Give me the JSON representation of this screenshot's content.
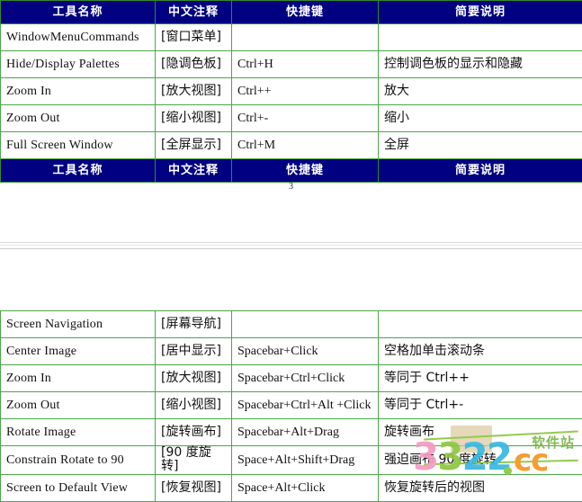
{
  "document": {
    "page_number": "3",
    "columns": [
      "工具名称",
      "中文注释",
      "快捷键",
      "简要说明"
    ]
  },
  "table_one": {
    "header": {
      "col1": "工具名称",
      "col2": "中文注释",
      "col3": "快捷键",
      "col4": "简要说明"
    },
    "footer_header": {
      "col1": "工具名称",
      "col2": "中文注释",
      "col3": "快捷键",
      "col4": "简要说明"
    },
    "rows": [
      {
        "name": "WindowMenuCommands",
        "cn": "[窗口菜单]",
        "key": "",
        "desc": "",
        "bold_name": true,
        "bold_key": false
      },
      {
        "name": "Hide/Display Palettes",
        "cn": "[隐调色板]",
        "key": "Ctrl+H",
        "desc": "控制调色板的显示和隐藏",
        "bold_name": false,
        "bold_key": false
      },
      {
        "name": "Zoom In",
        "cn": "[放大视图]",
        "key": "Ctrl++",
        "desc": "放大",
        "bold_name": false,
        "bold_key": false
      },
      {
        "name": "Zoom Out",
        "cn": "[缩小视图]",
        "key": "Ctrl+-",
        "desc": "缩小",
        "bold_name": false,
        "bold_key": false
      },
      {
        "name": "Full Screen Window",
        "cn": "[全屏显示]",
        "key": "Ctrl+M",
        "desc": "全屏",
        "bold_name": false,
        "bold_key": false
      }
    ]
  },
  "table_two": {
    "rows": [
      {
        "name": "Screen Navigation",
        "cn": "[屏幕导航]",
        "key": "",
        "desc": "",
        "bold_name": false,
        "bold_key": false
      },
      {
        "name": "Center Image",
        "cn": "[居中显示]",
        "key": "Spacebar+Click",
        "desc": "空格加单击滚动条",
        "bold_name": false,
        "bold_key": false
      },
      {
        "name": "Zoom In",
        "cn": "[放大视图]",
        "key": "Spacebar+Ctrl+Click",
        "desc": "等同于 Ctrl++",
        "bold_name": false,
        "bold_key": false
      },
      {
        "name": "Zoom Out",
        "cn": "[缩小视图]",
        "key": "Spacebar+Ctrl+Alt +Click",
        "desc": "等同于 Ctrl+-",
        "bold_name": false,
        "bold_key": true
      },
      {
        "name": "Rotate Image",
        "cn": "[旋转画布]",
        "key": "Spacebar+Alt+Drag",
        "desc": "旋转画布",
        "bold_name": false,
        "bold_key": false
      },
      {
        "name": "Constrain Rotate to 90",
        "cn": "[90 度旋转]",
        "key": "Space+Alt+Shift+Drag",
        "desc": "强迫画布 90 度旋转",
        "bold_name": false,
        "bold_key": false
      },
      {
        "name": "Screen to Default View",
        "cn": "[恢复视图]",
        "key": "Space+Alt+Click",
        "desc": "恢复旋转后的视图",
        "bold_name": false,
        "bold_key": false
      }
    ]
  },
  "watermark": {
    "digits": [
      "3",
      "3",
      "2",
      "2"
    ],
    "tld": "cc",
    "label": "软件站",
    "colors": {
      "digit1": "#f49ac1",
      "digit2": "#8cc63f",
      "digit3": "#39b7e0",
      "digit4": "#39b7e0",
      "tld": "#f7941e",
      "label": "#7ab648",
      "swoosh": "#8cc63f"
    }
  },
  "theme": {
    "header_background": "#000080",
    "header_text": "#ffffff",
    "border": "#4ca64c",
    "body_background": "#ffffff",
    "body_text": "#111111"
  }
}
